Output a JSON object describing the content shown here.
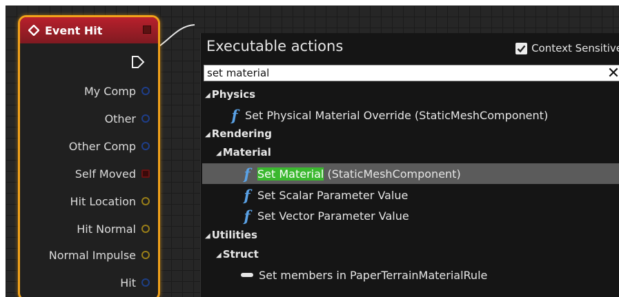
{
  "node": {
    "title": "Event Hit",
    "pins": [
      {
        "label": "My Comp",
        "kind": "object"
      },
      {
        "label": "Other",
        "kind": "object"
      },
      {
        "label": "Other Comp",
        "kind": "object"
      },
      {
        "label": "Self Moved",
        "kind": "bool"
      },
      {
        "label": "Hit Location",
        "kind": "vector"
      },
      {
        "label": "Hit Normal",
        "kind": "vector"
      },
      {
        "label": "Normal Impulse",
        "kind": "vector"
      },
      {
        "label": "Hit",
        "kind": "struct"
      }
    ]
  },
  "menu": {
    "title": "Executable actions",
    "context_sensitive_label": "Context Sensitive",
    "context_sensitive_checked": true,
    "search_value": "set material",
    "clear_icon": "close-icon",
    "categories": {
      "physics": "Physics",
      "rendering": "Rendering",
      "material": "Material",
      "utilities": "Utilities",
      "struct": "Struct"
    },
    "items": {
      "physical_override": "Set Physical Material Override (StaticMeshComponent)",
      "set_material_highlight": "Set Material",
      "set_material_rest": " (StaticMeshComponent)",
      "scalar": "Set Scalar Parameter Value",
      "vector": "Set Vector Parameter Value",
      "members": "Set members in PaperTerrainMaterialRule"
    },
    "function_glyph": "f"
  },
  "colors": {
    "node_border": "#f2a21a",
    "header": "#b8202c",
    "highlight": "#3bb82f",
    "function_icon": "#5aa2e6"
  }
}
